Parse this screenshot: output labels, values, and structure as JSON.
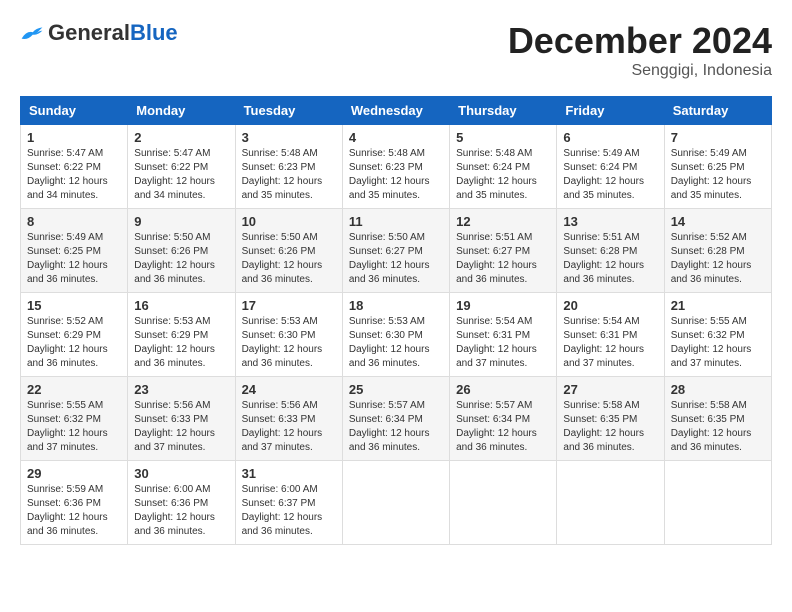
{
  "header": {
    "logo_general": "General",
    "logo_blue": "Blue",
    "month": "December 2024",
    "location": "Senggigi, Indonesia"
  },
  "weekdays": [
    "Sunday",
    "Monday",
    "Tuesday",
    "Wednesday",
    "Thursday",
    "Friday",
    "Saturday"
  ],
  "weeks": [
    [
      {
        "day": "1",
        "sunrise": "5:47 AM",
        "sunset": "6:22 PM",
        "daylight": "12 hours and 34 minutes."
      },
      {
        "day": "2",
        "sunrise": "5:47 AM",
        "sunset": "6:22 PM",
        "daylight": "12 hours and 34 minutes."
      },
      {
        "day": "3",
        "sunrise": "5:48 AM",
        "sunset": "6:23 PM",
        "daylight": "12 hours and 35 minutes."
      },
      {
        "day": "4",
        "sunrise": "5:48 AM",
        "sunset": "6:23 PM",
        "daylight": "12 hours and 35 minutes."
      },
      {
        "day": "5",
        "sunrise": "5:48 AM",
        "sunset": "6:24 PM",
        "daylight": "12 hours and 35 minutes."
      },
      {
        "day": "6",
        "sunrise": "5:49 AM",
        "sunset": "6:24 PM",
        "daylight": "12 hours and 35 minutes."
      },
      {
        "day": "7",
        "sunrise": "5:49 AM",
        "sunset": "6:25 PM",
        "daylight": "12 hours and 35 minutes."
      }
    ],
    [
      {
        "day": "8",
        "sunrise": "5:49 AM",
        "sunset": "6:25 PM",
        "daylight": "12 hours and 36 minutes."
      },
      {
        "day": "9",
        "sunrise": "5:50 AM",
        "sunset": "6:26 PM",
        "daylight": "12 hours and 36 minutes."
      },
      {
        "day": "10",
        "sunrise": "5:50 AM",
        "sunset": "6:26 PM",
        "daylight": "12 hours and 36 minutes."
      },
      {
        "day": "11",
        "sunrise": "5:50 AM",
        "sunset": "6:27 PM",
        "daylight": "12 hours and 36 minutes."
      },
      {
        "day": "12",
        "sunrise": "5:51 AM",
        "sunset": "6:27 PM",
        "daylight": "12 hours and 36 minutes."
      },
      {
        "day": "13",
        "sunrise": "5:51 AM",
        "sunset": "6:28 PM",
        "daylight": "12 hours and 36 minutes."
      },
      {
        "day": "14",
        "sunrise": "5:52 AM",
        "sunset": "6:28 PM",
        "daylight": "12 hours and 36 minutes."
      }
    ],
    [
      {
        "day": "15",
        "sunrise": "5:52 AM",
        "sunset": "6:29 PM",
        "daylight": "12 hours and 36 minutes."
      },
      {
        "day": "16",
        "sunrise": "5:53 AM",
        "sunset": "6:29 PM",
        "daylight": "12 hours and 36 minutes."
      },
      {
        "day": "17",
        "sunrise": "5:53 AM",
        "sunset": "6:30 PM",
        "daylight": "12 hours and 36 minutes."
      },
      {
        "day": "18",
        "sunrise": "5:53 AM",
        "sunset": "6:30 PM",
        "daylight": "12 hours and 36 minutes."
      },
      {
        "day": "19",
        "sunrise": "5:54 AM",
        "sunset": "6:31 PM",
        "daylight": "12 hours and 37 minutes."
      },
      {
        "day": "20",
        "sunrise": "5:54 AM",
        "sunset": "6:31 PM",
        "daylight": "12 hours and 37 minutes."
      },
      {
        "day": "21",
        "sunrise": "5:55 AM",
        "sunset": "6:32 PM",
        "daylight": "12 hours and 37 minutes."
      }
    ],
    [
      {
        "day": "22",
        "sunrise": "5:55 AM",
        "sunset": "6:32 PM",
        "daylight": "12 hours and 37 minutes."
      },
      {
        "day": "23",
        "sunrise": "5:56 AM",
        "sunset": "6:33 PM",
        "daylight": "12 hours and 37 minutes."
      },
      {
        "day": "24",
        "sunrise": "5:56 AM",
        "sunset": "6:33 PM",
        "daylight": "12 hours and 37 minutes."
      },
      {
        "day": "25",
        "sunrise": "5:57 AM",
        "sunset": "6:34 PM",
        "daylight": "12 hours and 36 minutes."
      },
      {
        "day": "26",
        "sunrise": "5:57 AM",
        "sunset": "6:34 PM",
        "daylight": "12 hours and 36 minutes."
      },
      {
        "day": "27",
        "sunrise": "5:58 AM",
        "sunset": "6:35 PM",
        "daylight": "12 hours and 36 minutes."
      },
      {
        "day": "28",
        "sunrise": "5:58 AM",
        "sunset": "6:35 PM",
        "daylight": "12 hours and 36 minutes."
      }
    ],
    [
      {
        "day": "29",
        "sunrise": "5:59 AM",
        "sunset": "6:36 PM",
        "daylight": "12 hours and 36 minutes."
      },
      {
        "day": "30",
        "sunrise": "6:00 AM",
        "sunset": "6:36 PM",
        "daylight": "12 hours and 36 minutes."
      },
      {
        "day": "31",
        "sunrise": "6:00 AM",
        "sunset": "6:37 PM",
        "daylight": "12 hours and 36 minutes."
      },
      null,
      null,
      null,
      null
    ]
  ]
}
